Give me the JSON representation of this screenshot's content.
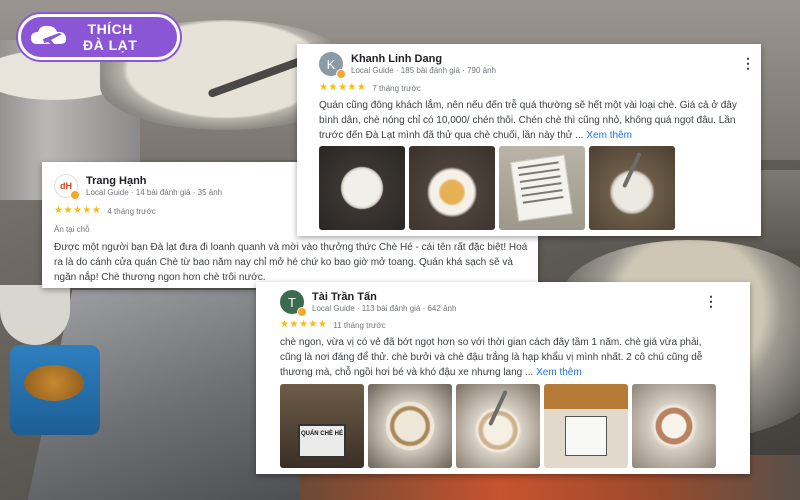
{
  "brand": {
    "line1": "THÍCH",
    "line2": "ĐÀ LẠT"
  },
  "reviews": [
    {
      "id": "khanh",
      "name": "Khanh Linh Dang",
      "meta": "Local Guide · 185 bài đánh giá · 790 ảnh",
      "avatar_letter": "K",
      "avatar_color": "#8a9aa6",
      "rating": 5,
      "stars": [
        "★",
        "★",
        "★",
        "★",
        "★"
      ],
      "time": "7 tháng trước",
      "text": "Quán cũng đông khách lắm, nên nếu đến trễ quá thường sẽ hết một vài loại chè. Giá cả ở đây bình dân, chè nóng chỉ có 10,000/ chén thôi. Chén chè thì cũng nhỏ, không quá ngọt đâu. Lần trước đến Đà Lạt mình đã thử qua chè chuối, lần này thử ...",
      "more": "Xem thêm",
      "photos": [
        "bowl-dark",
        "bowl-yellow",
        "menu",
        "bowl-white"
      ]
    },
    {
      "id": "trang",
      "name": "Trang Hạnh",
      "meta": "Local Guide · 14 bài đánh giá · 35 ảnh",
      "avatar_letter": "dH",
      "avatar_color": "#ffffff",
      "rating": 5,
      "stars": [
        "★",
        "★",
        "★",
        "★",
        "★"
      ],
      "time": "4 tháng trước",
      "dine": "Ăn tại chỗ",
      "text": "Được một người bạn Đà lạt đưa đi loanh quanh và mời vào thưởng thức Chè Hé - cái tên rất đặc biệt! Hoá ra là do cánh cửa quán Chè từ bao năm nay chỉ mở hé chứ ko bao giờ mở toang. Quán khá sạch sẽ và ngăn nắp! Chè thương ngon hơn chè trôi nước."
    },
    {
      "id": "tai",
      "name": "Tài Trần Tấn",
      "meta": "Local Guide · 113 bài đánh giá · 642 ảnh",
      "avatar_letter": "T",
      "avatar_color": "#3c6b4f",
      "rating": 5,
      "stars": [
        "★",
        "★",
        "★",
        "★",
        "★"
      ],
      "time": "11 tháng trước",
      "text": "chè ngon, vừa vị có vẻ đã bớt ngọt hơn so với thời gian cách đây tầm 1 năm. chè giá vừa phải, cũng là nơi đáng để thử. chè bưởi và chè đậu trắng là hạp khẩu vị mình nhất. 2 cô chú cũng dễ thương mà, chỗ ngồi hơi bé và khó đậu xe nhưng lang ...",
      "more": "Xem thêm",
      "photos": [
        "shop",
        "bowl-nuts",
        "bowl-bean",
        "shop2",
        "beans"
      ],
      "shop_sign": "QUÁN CHÈ HÉ"
    }
  ]
}
